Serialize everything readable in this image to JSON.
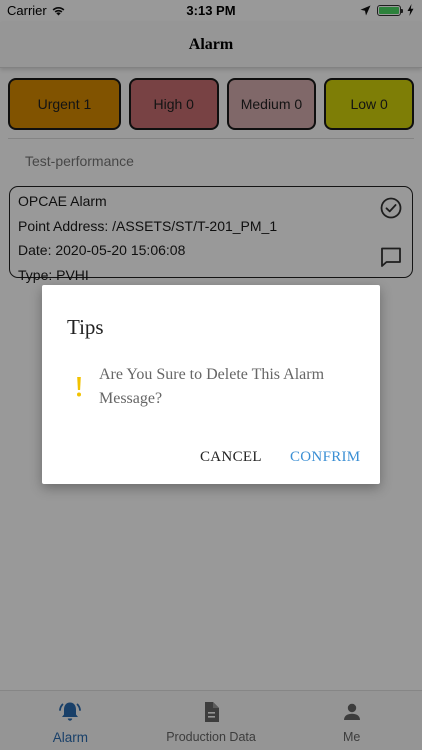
{
  "status_bar": {
    "carrier": "Carrier",
    "time": "3:13 PM"
  },
  "header": {
    "title": "Alarm"
  },
  "levels": [
    {
      "label": "Urgent 1",
      "color": "#d88a00"
    },
    {
      "label": "High 0",
      "color": "#c96f72"
    },
    {
      "label": "Medium 0",
      "color": "#d6aeb0"
    },
    {
      "label": "Low 0",
      "color": "#d3d20a"
    }
  ],
  "group": {
    "label": "Test-performance"
  },
  "alarm": {
    "title": "OPCAE Alarm",
    "point_address": "Point Address: /ASSETS/ST/T-201_PM_1",
    "date": "Date: 2020-05-20 15:06:08",
    "type": "Type: PVHI"
  },
  "dialog": {
    "title": "Tips",
    "message": "Are You Sure to Delete This Alarm Message?",
    "cancel_label": "CANCEL",
    "confirm_label": "CONFRIM",
    "warn_color": "#f2c200"
  },
  "tabs": [
    {
      "label": "Alarm",
      "icon": "bell-icon",
      "active": true
    },
    {
      "label": "Production Data",
      "icon": "document-icon",
      "active": false
    },
    {
      "label": "Me",
      "icon": "person-icon",
      "active": false
    }
  ],
  "colors": {
    "accent": "#3b8fd4",
    "tab_active": "#2b6cb0"
  }
}
